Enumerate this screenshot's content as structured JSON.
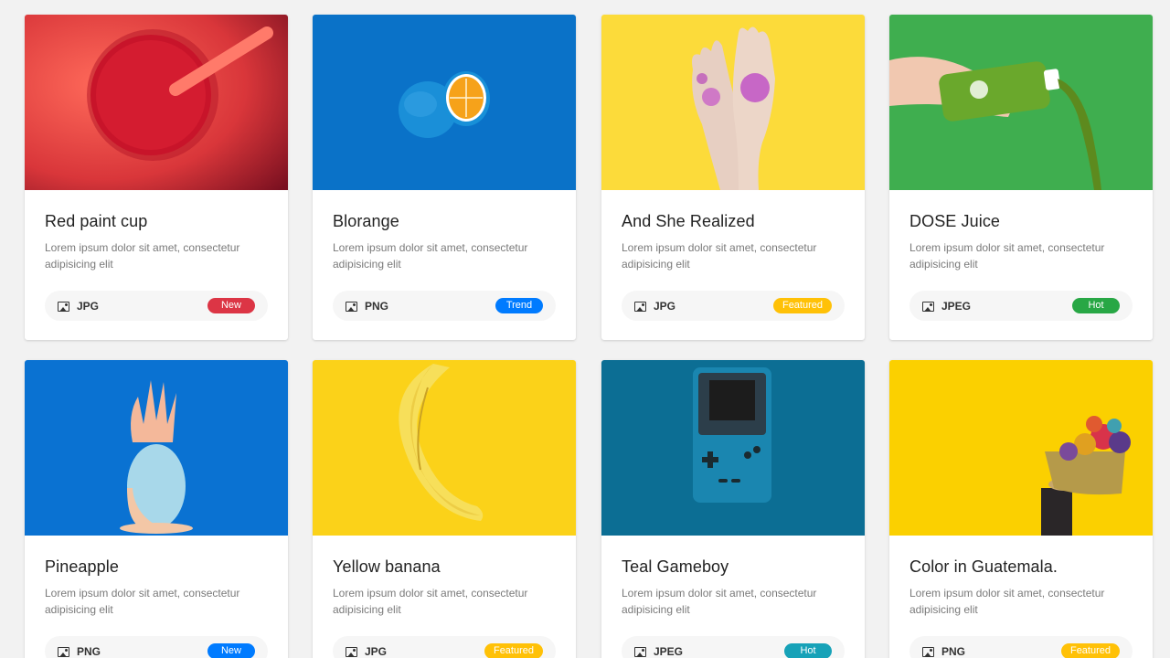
{
  "colors": {
    "new": "#dc3545",
    "trend": "#007bff",
    "featured": "#ffc107",
    "hot_green": "#28a745",
    "new_blue": "#007bff",
    "hot_teal": "#17a2b8"
  },
  "cards": [
    {
      "title": "Red paint cup",
      "description": "Lorem ipsum dolor sit amet, consectetur adipisicing elit",
      "file_type": "JPG",
      "badge": "New",
      "badge_color": "#dc3545",
      "image_icon": "image-icon"
    },
    {
      "title": "Blorange",
      "description": "Lorem ipsum dolor sit amet, consectetur adipisicing elit",
      "file_type": "PNG",
      "badge": "Trend",
      "badge_color": "#007bff",
      "image_icon": "image-icon"
    },
    {
      "title": "And She Realized",
      "description": "Lorem ipsum dolor sit amet, consectetur adipisicing elit",
      "file_type": "JPG",
      "badge": "Featured",
      "badge_color": "#ffc107",
      "image_icon": "image-icon"
    },
    {
      "title": "DOSE Juice",
      "description": "Lorem ipsum dolor sit amet, consectetur adipisicing elit",
      "file_type": "JPEG",
      "badge": "Hot",
      "badge_color": "#28a745",
      "image_icon": "image-icon"
    },
    {
      "title": "Pineapple",
      "description": "Lorem ipsum dolor sit amet, consectetur adipisicing elit",
      "file_type": "PNG",
      "badge": "New",
      "badge_color": "#007bff",
      "image_icon": "image-icon"
    },
    {
      "title": "Yellow banana",
      "description": "Lorem ipsum dolor sit amet, consectetur adipisicing elit",
      "file_type": "JPG",
      "badge": "Featured",
      "badge_color": "#ffc107",
      "image_icon": "image-icon"
    },
    {
      "title": "Teal Gameboy",
      "description": "Lorem ipsum dolor sit amet, consectetur adipisicing elit",
      "file_type": "JPEG",
      "badge": "Hot",
      "badge_color": "#17a2b8",
      "image_icon": "image-icon"
    },
    {
      "title": "Color in Guatemala.",
      "description": "Lorem ipsum dolor sit amet, consectetur adipisicing elit",
      "file_type": "PNG",
      "badge": "Featured",
      "badge_color": "#ffc107",
      "image_icon": "image-icon"
    }
  ]
}
